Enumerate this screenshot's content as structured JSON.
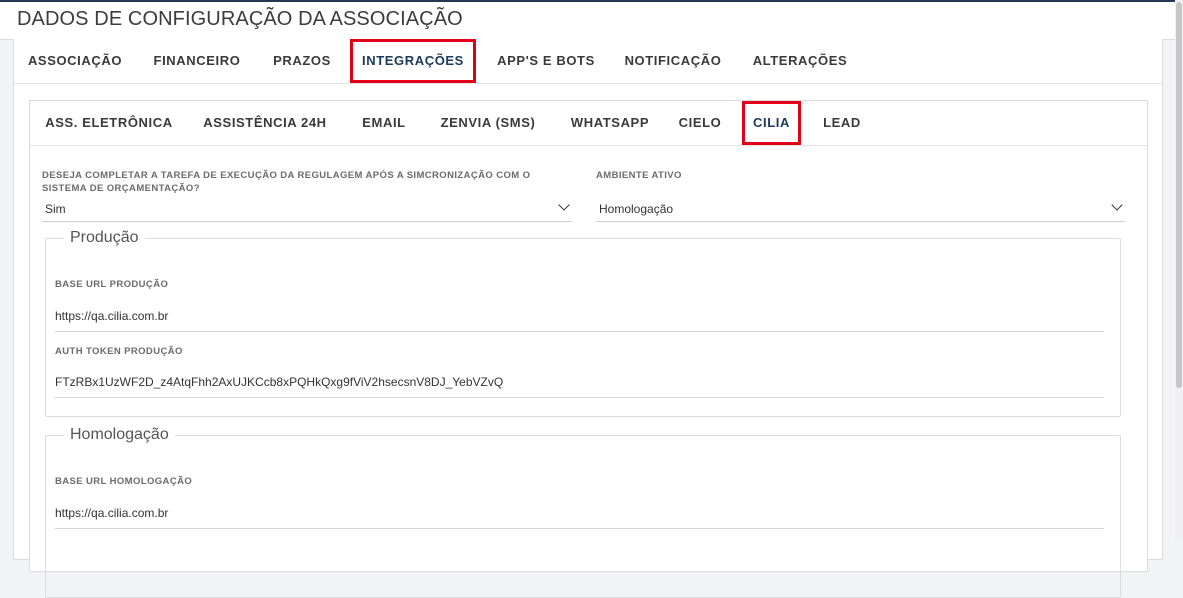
{
  "header": {
    "title": "DADOS DE CONFIGURAÇÃO DA ASSOCIAÇÃO"
  },
  "main_tabs": [
    {
      "label": "ASSOCIAÇÃO"
    },
    {
      "label": "FINANCEIRO"
    },
    {
      "label": "PRAZOS"
    },
    {
      "label": "INTEGRAÇÕES",
      "active": true
    },
    {
      "label": "APP'S E BOTS"
    },
    {
      "label": "NOTIFICAÇÃO"
    },
    {
      "label": "ALTERAÇÕES"
    }
  ],
  "sub_tabs": [
    {
      "label": "ASS. ELETRÔNICA"
    },
    {
      "label": "ASSISTÊNCIA 24H"
    },
    {
      "label": "EMAIL"
    },
    {
      "label": "ZENVIA (SMS)"
    },
    {
      "label": "WHATSAPP"
    },
    {
      "label": "CIELO"
    },
    {
      "label": "CILIA",
      "active": true
    },
    {
      "label": "LEAD"
    }
  ],
  "form": {
    "complete_task": {
      "label": "DESEJA COMPLETAR A TAREFA DE EXECUÇÃO DA REGULAGEM APÓS A SIMCRONIZAÇÃO COM O SISTEMA DE ORÇAMENTAÇÃO?",
      "value": "Sim"
    },
    "environment": {
      "label": "AMBIENTE ATIVO",
      "value": "Homologação"
    }
  },
  "producao": {
    "legend": "Produção",
    "base_url_label": "BASE URL PRODUÇÃO",
    "base_url_value": "https://qa.cilia.com.br",
    "token_label": "AUTH TOKEN PRODUÇÃO",
    "token_value": "FTzRBx1UzWF2D_z4AtqFhh2AxUJKCcb8xPQHkQxg9fViV2hsecsnV8DJ_YebVZvQ"
  },
  "homologacao": {
    "legend": "Homologação",
    "base_url_label": "BASE URL HOMOLOGAÇÃO",
    "base_url_value": "https://qa.cilia.com.br"
  },
  "colors": {
    "active_tab": "#1c3a5c",
    "highlight_box": "#e1001a",
    "top_bar": "#26384d"
  }
}
